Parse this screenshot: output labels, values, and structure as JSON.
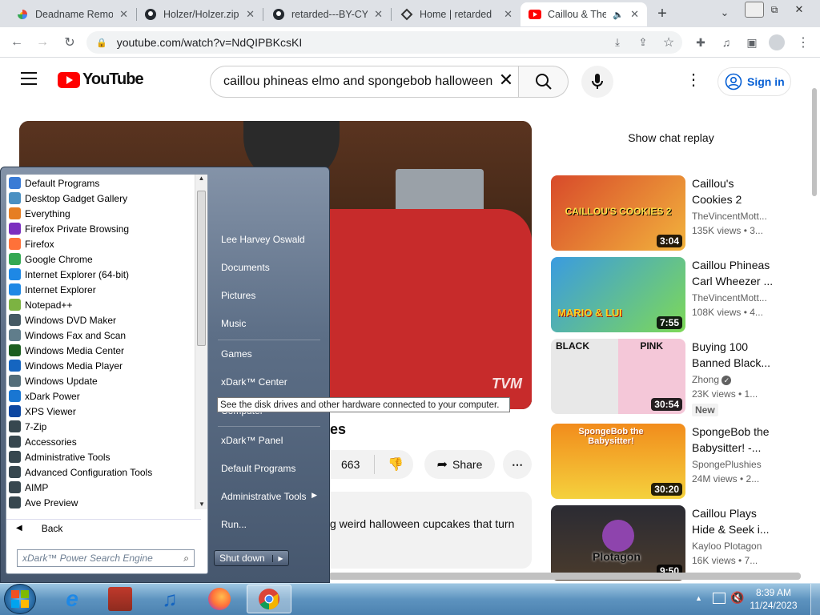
{
  "browser": {
    "tabs": [
      {
        "title": "Deadname Remo",
        "icon": "google-photos-icon"
      },
      {
        "title": "Holzer/Holzer.zip",
        "icon": "github-icon"
      },
      {
        "title": "retarded---BY-CY",
        "icon": "github-icon"
      },
      {
        "title": "Home | retarded",
        "icon": "site-icon"
      },
      {
        "title": "Caillou & The",
        "icon": "youtube-icon"
      }
    ],
    "address": "youtube.com/watch?v=NdQIPBKcsKI"
  },
  "youtube": {
    "logo_text": "YouTube",
    "search_query": "caillou phineas elmo and spongebob halloween",
    "sign_in": "Sign in",
    "chat_replay": "Show chat replay",
    "video_title_fragment": "es",
    "like_count": "663",
    "share_label": "Share",
    "description_fragment": "g weird halloween cupcakes that turn",
    "watermark": "TVM",
    "recommendations": [
      {
        "title": "Caillou's Cookies 2",
        "channel": "TheVincentMott...",
        "meta": "135K views • 3...",
        "duration": "3:04",
        "thumb_text": "CAILLOU'S COOKIES 2",
        "badge": ""
      },
      {
        "title": "Caillou Phineas Carl Wheezer ...",
        "channel": "TheVincentMott...",
        "meta": "108K views • 4...",
        "duration": "7:55",
        "thumb_text": "MARIO & LUI",
        "badge": ""
      },
      {
        "title": "Buying 100 Banned Black...",
        "channel": "Zhong",
        "meta": "23K views • 1...",
        "duration": "30:54",
        "thumb_text": "BLACK PINK",
        "badge": "New"
      },
      {
        "title": "SpongeBob the Babysitter! -...",
        "channel": "SpongePlushies",
        "meta": "24M views • 2...",
        "duration": "30:20",
        "thumb_text": "SpongeBob the Babysitter!",
        "badge": ""
      },
      {
        "title": "Caillou Plays Hide & Seek i...",
        "channel": "Kayloo Plotagon",
        "meta": "16K views • 7...",
        "duration": "9:50",
        "thumb_text": "Plotagon",
        "badge": ""
      }
    ]
  },
  "startmenu": {
    "programs": [
      {
        "label": "Default Programs",
        "icon": "default-programs-icon",
        "color": "#3a7bd5"
      },
      {
        "label": "Desktop Gadget Gallery",
        "icon": "gadget-icon",
        "color": "#4a90c2"
      },
      {
        "label": "Everything",
        "icon": "magnifier-icon",
        "color": "#e67e22"
      },
      {
        "label": "Firefox Private Browsing",
        "icon": "firefox-private-icon",
        "color": "#7b2fbf"
      },
      {
        "label": "Firefox",
        "icon": "firefox-icon",
        "color": "#ff7139"
      },
      {
        "label": "Google Chrome",
        "icon": "chrome-icon",
        "color": "#34a853"
      },
      {
        "label": "Internet Explorer (64-bit)",
        "icon": "ie-icon",
        "color": "#1e88e5"
      },
      {
        "label": "Internet Explorer",
        "icon": "ie-icon",
        "color": "#1e88e5"
      },
      {
        "label": "Notepad++",
        "icon": "notepad-icon",
        "color": "#7cb342"
      },
      {
        "label": "Windows DVD Maker",
        "icon": "dvd-icon",
        "color": "#455a64"
      },
      {
        "label": "Windows Fax and Scan",
        "icon": "fax-icon",
        "color": "#607d8b"
      },
      {
        "label": "Windows Media Center",
        "icon": "media-center-icon",
        "color": "#1b5e20"
      },
      {
        "label": "Windows Media Player",
        "icon": "media-player-icon",
        "color": "#1565c0"
      },
      {
        "label": "Windows Update",
        "icon": "update-icon",
        "color": "#546e7a"
      },
      {
        "label": "xDark Power",
        "icon": "power-icon",
        "color": "#1976d2"
      },
      {
        "label": "XPS Viewer",
        "icon": "xps-icon",
        "color": "#0d47a1"
      },
      {
        "label": "7-Zip",
        "icon": "folder-icon",
        "color": "#37474f"
      },
      {
        "label": "Accessories",
        "icon": "folder-icon",
        "color": "#37474f"
      },
      {
        "label": "Administrative Tools",
        "icon": "folder-icon",
        "color": "#37474f"
      },
      {
        "label": "Advanced Configuration Tools",
        "icon": "folder-icon",
        "color": "#37474f"
      },
      {
        "label": "AIMP",
        "icon": "folder-icon",
        "color": "#37474f"
      },
      {
        "label": "Ave Preview",
        "icon": "folder-icon",
        "color": "#37474f"
      }
    ],
    "back": "Back",
    "search_placeholder": "xDark™ Power Search Engine",
    "right_links": [
      "Lee Harvey Oswald",
      "Documents",
      "Pictures",
      "Music",
      "Games",
      "xDark™ Center",
      "Computer",
      "xDark™ Panel",
      "Default Programs",
      "Administrative Tools",
      "Run..."
    ],
    "shutdown": "Shut down",
    "tooltip": "See the disk drives and other hardware connected to your computer."
  },
  "taskbar": {
    "time": "8:39 AM",
    "date": "11/24/2023"
  }
}
